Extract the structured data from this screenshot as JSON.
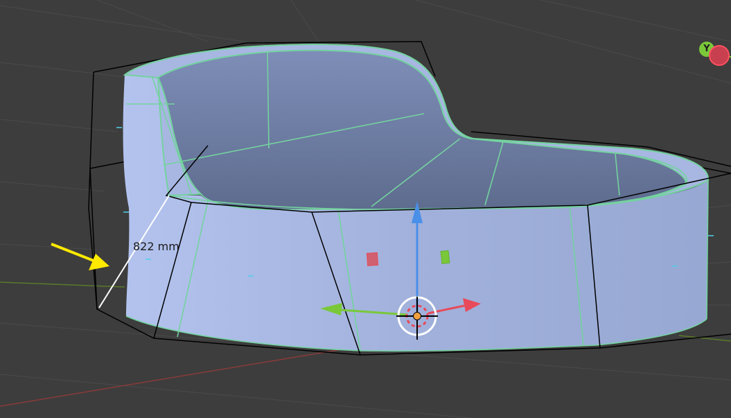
{
  "viewport": {
    "measurement": {
      "label": "822 mm"
    },
    "navigation_gizmo": {
      "axis_label": "Y"
    }
  },
  "colors": {
    "background": "#3d3d3d",
    "grid_line": "#4a4a4a",
    "x_axis_line": "#8a3a3a",
    "y_axis_line": "#5a7a2a",
    "mesh_face": "#a3b3dc",
    "mesh_edge": "#74d29f",
    "cage_line": "#000000",
    "gizmo_z": "#4a8fe8",
    "gizmo_x": "#e84a5a",
    "gizmo_y": "#7ac83a",
    "annotation_arrow": "#ffea00"
  }
}
